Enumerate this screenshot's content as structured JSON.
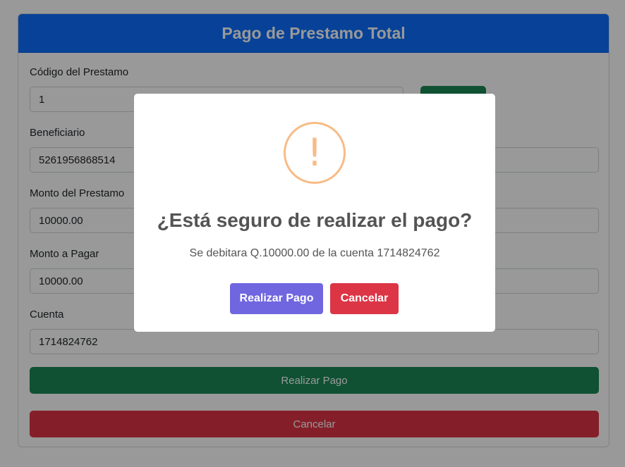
{
  "header": {
    "title": "Pago de Prestamo Total"
  },
  "form": {
    "codigo_label": "Código del Prestamo",
    "codigo_value": "1",
    "beneficiario_label": "Beneficiario",
    "beneficiario_value": "5261956868514",
    "monto_prestamo_label": "Monto del Prestamo",
    "monto_prestamo_value": "10000.00",
    "monto_pagar_label": "Monto a Pagar",
    "monto_pagar_value": "10000.00",
    "cuenta_label": "Cuenta",
    "cuenta_value": "1714824762",
    "submit_label": "Realizar Pago",
    "cancel_label": "Cancelar"
  },
  "modal": {
    "icon": "!",
    "title": "¿Está seguro de realizar el pago?",
    "text": "Se debitara Q.10000.00 de la cuenta 1714824762",
    "confirm_label": "Realizar Pago",
    "cancel_label": "Cancelar"
  },
  "colors": {
    "header": "#0d6efd",
    "success": "#198754",
    "danger": "#dc3545",
    "confirm": "#7066e0",
    "warning_icon": "#f8bb86"
  }
}
